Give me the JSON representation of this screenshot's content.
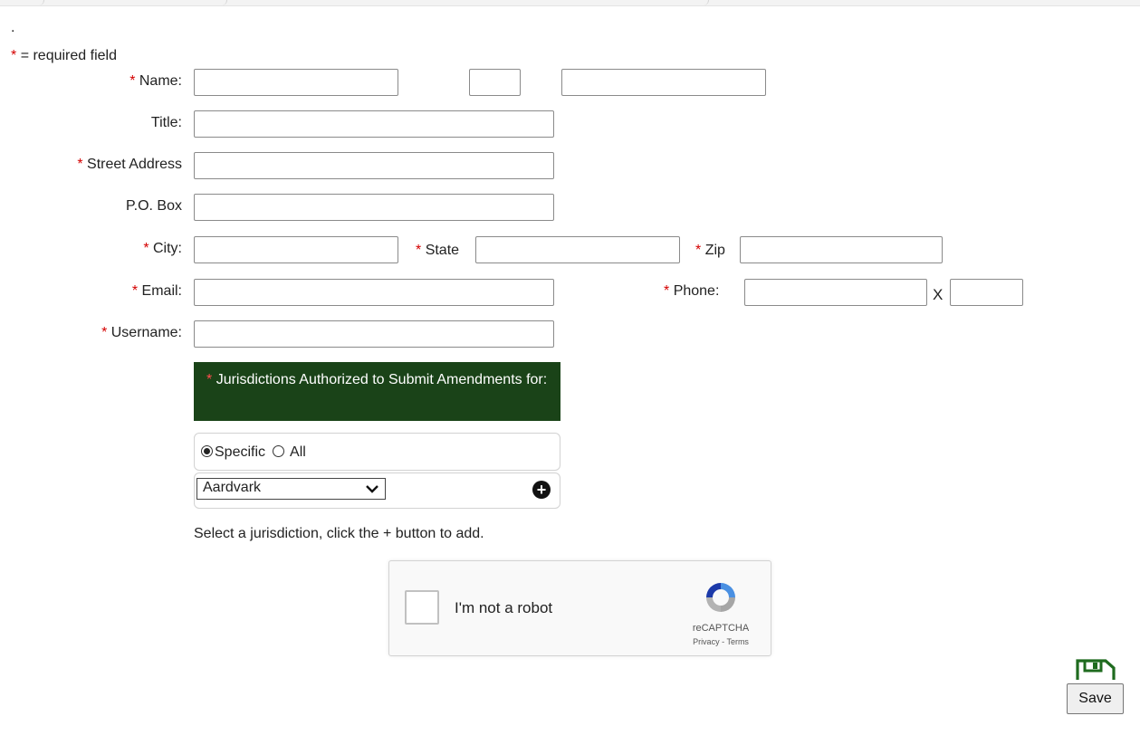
{
  "top_dot": ".",
  "required_note": {
    "star": "*",
    "text": "= required field"
  },
  "form": {
    "name": {
      "star": "*",
      "label": "Name:",
      "first_value": "",
      "middle_value": "",
      "last_value": ""
    },
    "title": {
      "label": "Title:",
      "value": ""
    },
    "street": {
      "star": "*",
      "label": "Street Address",
      "value": ""
    },
    "pobox": {
      "label": "P.O. Box",
      "value": ""
    },
    "city": {
      "star": "*",
      "label": "City:",
      "value": ""
    },
    "state": {
      "star": "*",
      "label": "State",
      "value": ""
    },
    "zip": {
      "star": "*",
      "label": "Zip",
      "value": ""
    },
    "email": {
      "star": "*",
      "label": "Email:",
      "value": ""
    },
    "phone": {
      "star": "*",
      "label": "Phone:",
      "value": "",
      "ext_sep": "X",
      "ext_value": ""
    },
    "username": {
      "star": "*",
      "label": "Username:",
      "value": ""
    }
  },
  "jurisdictions": {
    "star": "*",
    "header": "Jurisdictions Authorized to Submit Amendments for:",
    "radio_specific": "Specific",
    "radio_all": "All",
    "selected_option": "Aardvark",
    "selected_radio": "Specific",
    "help_text": "Select a jurisdiction, click the + button to add.",
    "add_glyph": "+"
  },
  "captcha": {
    "label": "I'm not a robot",
    "brand": "reCAPTCHA",
    "privacy": "Privacy",
    "separator": "-",
    "terms": "Terms"
  },
  "save": {
    "label": "Save"
  },
  "colors": {
    "required": "#d40000",
    "header_bg": "#1a4318",
    "save_icon": "#1f6b1f"
  },
  "icons": {
    "add": "plus-circle-icon",
    "dropdown": "chevron-down-icon",
    "save": "floppy-disk-icon",
    "captcha": "recaptcha-logo-icon"
  }
}
